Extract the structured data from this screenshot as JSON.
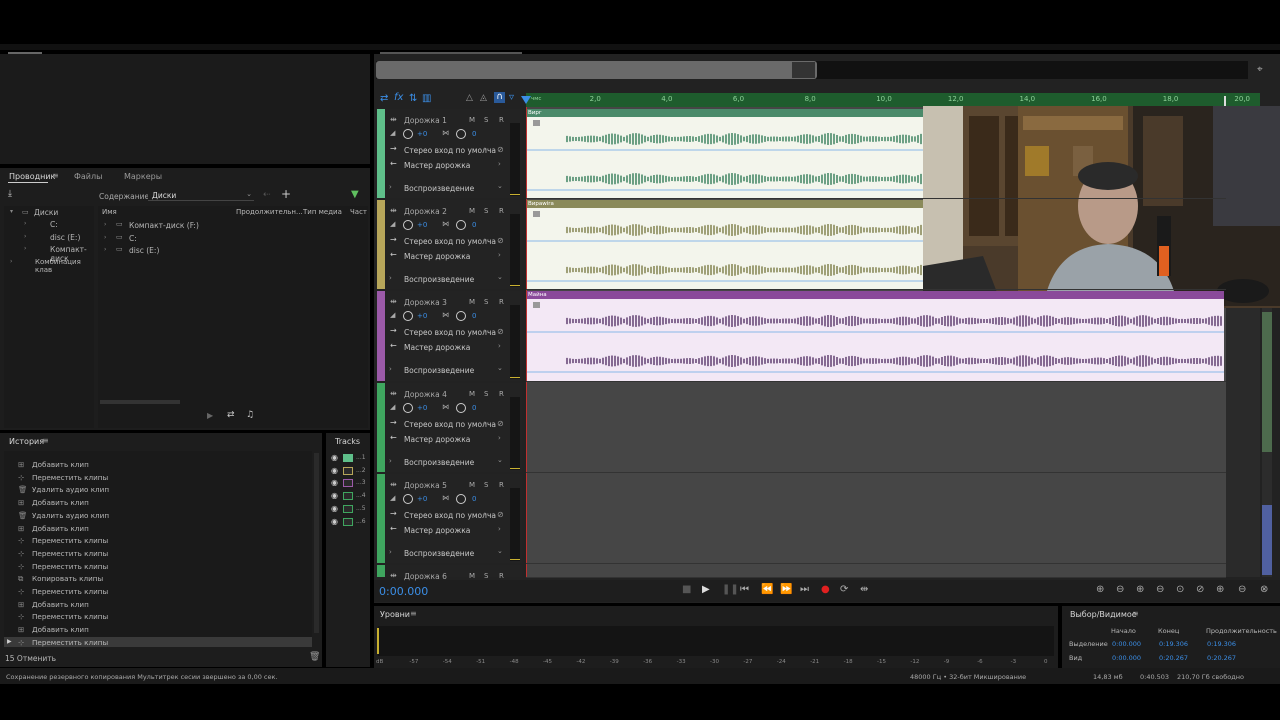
{
  "explorer": {
    "tabs": [
      "Проводник",
      "Файлы",
      "Маркеры"
    ],
    "content_label": "Содержание:",
    "content_value": "Диски",
    "tree": [
      "Диски",
      "C:",
      "disc (E:)",
      "Компакт-диск",
      "Комбинация клав"
    ],
    "columns": [
      "Имя",
      "Продолжительн...",
      "Тип медиа",
      "Част"
    ],
    "files": [
      "Компакт-диск (F:)",
      "C:",
      "disc (E:)"
    ]
  },
  "history": {
    "title": "История",
    "items": [
      "Добавить клип",
      "Переместить клипы",
      "Удалить аудио клип",
      "Добавить клип",
      "Удалить аудио клип",
      "Добавить клип",
      "Переместить клипы",
      "Переместить клипы",
      "Переместить клипы",
      "Копировать клипы",
      "Переместить клипы",
      "Добавить клип",
      "Переместить клипы",
      "Добавить клип",
      "Переместить клипы"
    ],
    "undo_count": "15 Отменить"
  },
  "tracks_panel": {
    "title": "Tracks",
    "labels": [
      "...1",
      "...2",
      "...3",
      "...4",
      "...5",
      "...6"
    ]
  },
  "timeline": {
    "ruler_start": "чмс",
    "ruler_ticks": [
      "2,0",
      "4,0",
      "6,0",
      "8,0",
      "10,0",
      "12,0",
      "14,0",
      "16,0",
      "18,0",
      "20,0"
    ],
    "time_display": "0:00.000"
  },
  "tracks": [
    {
      "name": "Дорожка 1",
      "volume": "+0",
      "pan": "0",
      "input": "Стерео вход по умолча",
      "output": "Мастер дорожка",
      "mode": "Воспроизведение",
      "clip": "Вирг",
      "color": "#5fbf8a"
    },
    {
      "name": "Дорожка 2",
      "volume": "+0",
      "pan": "0",
      "input": "Стерео вход по умолча",
      "output": "Мастер дорожка",
      "mode": "Воспроизведение",
      "clip": "Вирawira",
      "color": "#b7a65a"
    },
    {
      "name": "Дорожка 3",
      "volume": "+0",
      "pan": "0",
      "input": "Стерео вход по умолча",
      "output": "Мастер дорожка",
      "mode": "Воспроизведение",
      "clip": "Майна",
      "color": "#9b5aa8"
    },
    {
      "name": "Дорожка 4",
      "volume": "+0",
      "pan": "0",
      "input": "Стерео вход по умолча",
      "output": "Мастер дорожка",
      "mode": "Воспроизведение",
      "clip": "",
      "color": "#3fa65f"
    },
    {
      "name": "Дорожка 5",
      "volume": "+0",
      "pan": "0",
      "input": "Стерео вход по умолча",
      "output": "Мастер дорожка",
      "mode": "Воспроизведение",
      "clip": "",
      "color": "#3fa65f"
    },
    {
      "name": "Дорожка 6",
      "volume": "",
      "pan": "",
      "input": "",
      "output": "",
      "mode": "",
      "clip": "",
      "color": "#3fa65f"
    }
  ],
  "levels": {
    "title": "Уровни",
    "scale": [
      "dB",
      "-57",
      "-54",
      "-51",
      "-48",
      "-45",
      "-42",
      "-39",
      "-36",
      "-33",
      "-30",
      "-27",
      "-24",
      "-21",
      "-18",
      "-15",
      "-12",
      "-9",
      "-6",
      "-3",
      "0"
    ]
  },
  "selection": {
    "title": "Выбор/Видимое",
    "headers": [
      "Начало",
      "Конец",
      "Продолжительность"
    ],
    "rows": [
      {
        "label": "Выделение",
        "start": "0:00.000",
        "end": "0:19.306",
        "duration": "0:19.306"
      },
      {
        "label": "Вид",
        "start": "0:00.000",
        "end": "0:20.267",
        "duration": "0:20.267"
      }
    ]
  },
  "status": {
    "message": "Сохранение резервного копирования Мультитрек сесии звершено за 0,00 сек.",
    "format": "48000 Гц • 32-бит Микширование",
    "size": "14,83 мб",
    "duration": "0:40.503",
    "free": "210,70 Гб свободно"
  },
  "colors": {
    "accent": "#3b8ee6",
    "ruler": "#1e5c2d",
    "record": "#e02020"
  },
  "icons": [
    "sort-icon",
    "fx-icon",
    "play-icon",
    "record-icon",
    "zoom-icon",
    "trash-icon",
    "menu-icon",
    "eye-icon"
  ]
}
